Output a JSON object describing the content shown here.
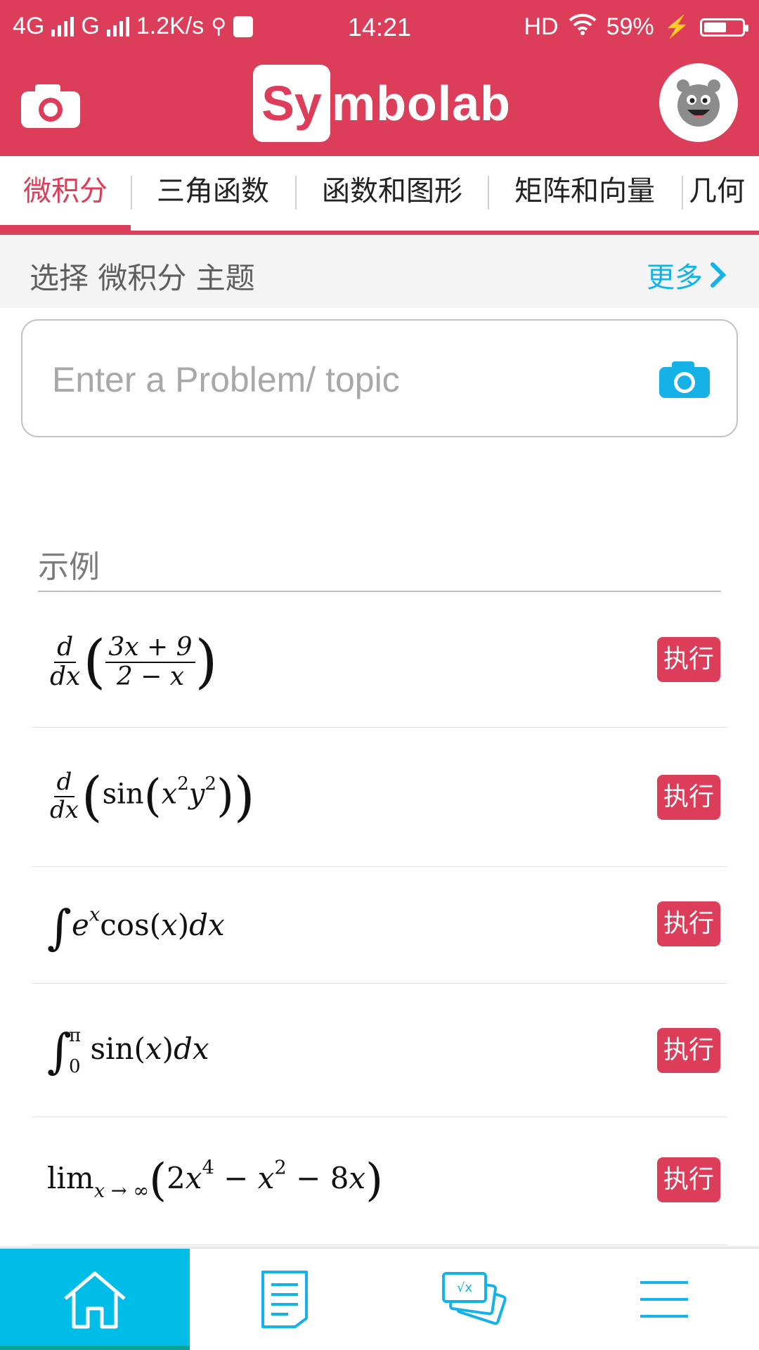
{
  "status_bar": {
    "network_1": "4G",
    "network_2": "G",
    "speed": "1.2K/s",
    "time": "14:21",
    "hd": "HD",
    "battery_percent": "59%",
    "battery_level": 0.59
  },
  "header": {
    "logo_box": "Sy",
    "logo_rest": "mbolab"
  },
  "tabs": [
    {
      "label": "微积分",
      "active": true
    },
    {
      "label": "三角函数"
    },
    {
      "label": "函数和图形"
    },
    {
      "label": "矩阵和向量"
    },
    {
      "label": "几何"
    }
  ],
  "topic": {
    "label": "选择 微积分 主题",
    "more": "更多"
  },
  "search": {
    "placeholder": "Enter a Problem/ topic",
    "value": ""
  },
  "examples": {
    "title": "示例",
    "run_label": "执行"
  },
  "bottom_nav": [
    {
      "icon": "home-icon",
      "active": true
    },
    {
      "icon": "notebook-icon"
    },
    {
      "icon": "flashcards-icon"
    },
    {
      "icon": "menu-icon"
    }
  ],
  "colors": {
    "brand": "#dc3d58",
    "accent": "#14b2e6",
    "nav_active": "#00bde8"
  }
}
